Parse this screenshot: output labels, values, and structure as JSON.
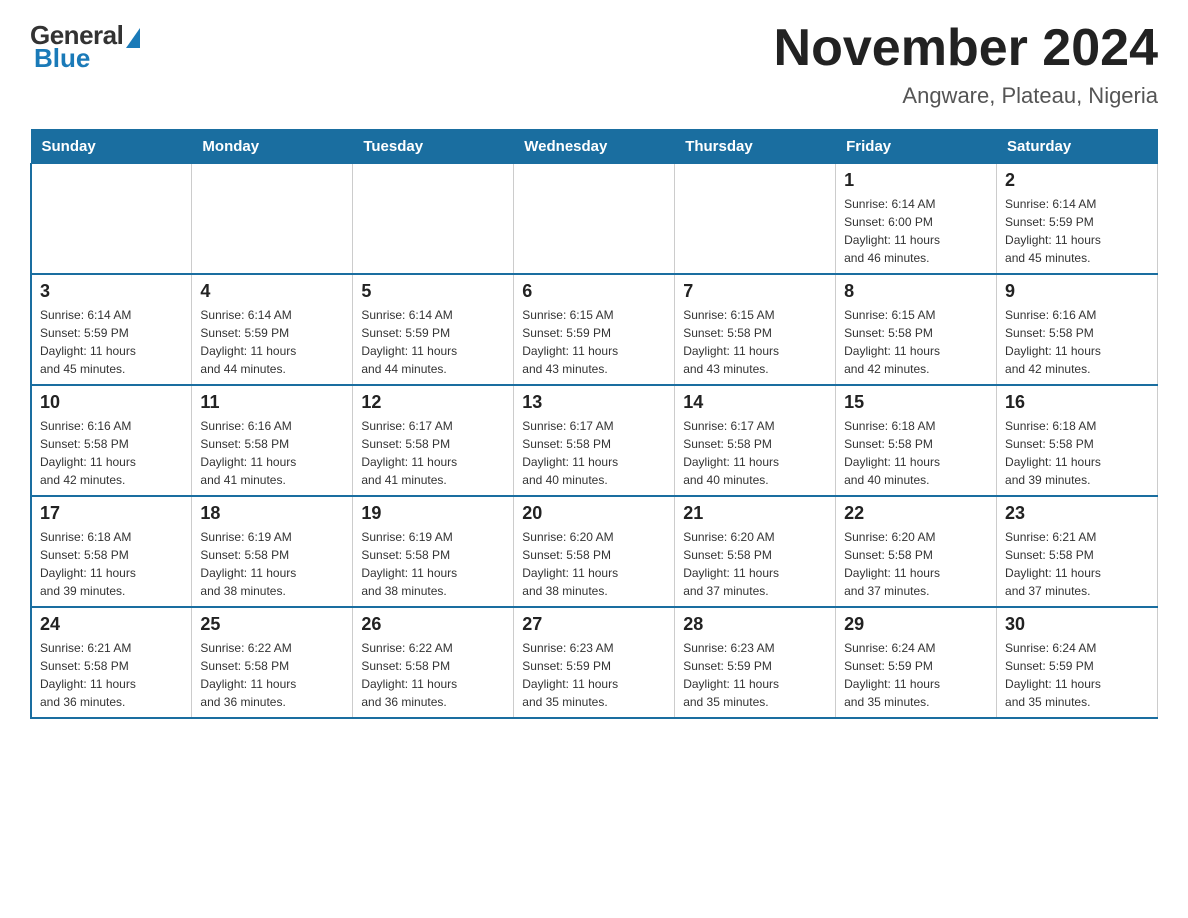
{
  "logo": {
    "general": "General",
    "blue": "Blue"
  },
  "title": "November 2024",
  "subtitle": "Angware, Plateau, Nigeria",
  "days_of_week": [
    "Sunday",
    "Monday",
    "Tuesday",
    "Wednesday",
    "Thursday",
    "Friday",
    "Saturday"
  ],
  "weeks": [
    [
      {
        "day": "",
        "info": ""
      },
      {
        "day": "",
        "info": ""
      },
      {
        "day": "",
        "info": ""
      },
      {
        "day": "",
        "info": ""
      },
      {
        "day": "",
        "info": ""
      },
      {
        "day": "1",
        "info": "Sunrise: 6:14 AM\nSunset: 6:00 PM\nDaylight: 11 hours\nand 46 minutes."
      },
      {
        "day": "2",
        "info": "Sunrise: 6:14 AM\nSunset: 5:59 PM\nDaylight: 11 hours\nand 45 minutes."
      }
    ],
    [
      {
        "day": "3",
        "info": "Sunrise: 6:14 AM\nSunset: 5:59 PM\nDaylight: 11 hours\nand 45 minutes."
      },
      {
        "day": "4",
        "info": "Sunrise: 6:14 AM\nSunset: 5:59 PM\nDaylight: 11 hours\nand 44 minutes."
      },
      {
        "day": "5",
        "info": "Sunrise: 6:14 AM\nSunset: 5:59 PM\nDaylight: 11 hours\nand 44 minutes."
      },
      {
        "day": "6",
        "info": "Sunrise: 6:15 AM\nSunset: 5:59 PM\nDaylight: 11 hours\nand 43 minutes."
      },
      {
        "day": "7",
        "info": "Sunrise: 6:15 AM\nSunset: 5:58 PM\nDaylight: 11 hours\nand 43 minutes."
      },
      {
        "day": "8",
        "info": "Sunrise: 6:15 AM\nSunset: 5:58 PM\nDaylight: 11 hours\nand 42 minutes."
      },
      {
        "day": "9",
        "info": "Sunrise: 6:16 AM\nSunset: 5:58 PM\nDaylight: 11 hours\nand 42 minutes."
      }
    ],
    [
      {
        "day": "10",
        "info": "Sunrise: 6:16 AM\nSunset: 5:58 PM\nDaylight: 11 hours\nand 42 minutes."
      },
      {
        "day": "11",
        "info": "Sunrise: 6:16 AM\nSunset: 5:58 PM\nDaylight: 11 hours\nand 41 minutes."
      },
      {
        "day": "12",
        "info": "Sunrise: 6:17 AM\nSunset: 5:58 PM\nDaylight: 11 hours\nand 41 minutes."
      },
      {
        "day": "13",
        "info": "Sunrise: 6:17 AM\nSunset: 5:58 PM\nDaylight: 11 hours\nand 40 minutes."
      },
      {
        "day": "14",
        "info": "Sunrise: 6:17 AM\nSunset: 5:58 PM\nDaylight: 11 hours\nand 40 minutes."
      },
      {
        "day": "15",
        "info": "Sunrise: 6:18 AM\nSunset: 5:58 PM\nDaylight: 11 hours\nand 40 minutes."
      },
      {
        "day": "16",
        "info": "Sunrise: 6:18 AM\nSunset: 5:58 PM\nDaylight: 11 hours\nand 39 minutes."
      }
    ],
    [
      {
        "day": "17",
        "info": "Sunrise: 6:18 AM\nSunset: 5:58 PM\nDaylight: 11 hours\nand 39 minutes."
      },
      {
        "day": "18",
        "info": "Sunrise: 6:19 AM\nSunset: 5:58 PM\nDaylight: 11 hours\nand 38 minutes."
      },
      {
        "day": "19",
        "info": "Sunrise: 6:19 AM\nSunset: 5:58 PM\nDaylight: 11 hours\nand 38 minutes."
      },
      {
        "day": "20",
        "info": "Sunrise: 6:20 AM\nSunset: 5:58 PM\nDaylight: 11 hours\nand 38 minutes."
      },
      {
        "day": "21",
        "info": "Sunrise: 6:20 AM\nSunset: 5:58 PM\nDaylight: 11 hours\nand 37 minutes."
      },
      {
        "day": "22",
        "info": "Sunrise: 6:20 AM\nSunset: 5:58 PM\nDaylight: 11 hours\nand 37 minutes."
      },
      {
        "day": "23",
        "info": "Sunrise: 6:21 AM\nSunset: 5:58 PM\nDaylight: 11 hours\nand 37 minutes."
      }
    ],
    [
      {
        "day": "24",
        "info": "Sunrise: 6:21 AM\nSunset: 5:58 PM\nDaylight: 11 hours\nand 36 minutes."
      },
      {
        "day": "25",
        "info": "Sunrise: 6:22 AM\nSunset: 5:58 PM\nDaylight: 11 hours\nand 36 minutes."
      },
      {
        "day": "26",
        "info": "Sunrise: 6:22 AM\nSunset: 5:58 PM\nDaylight: 11 hours\nand 36 minutes."
      },
      {
        "day": "27",
        "info": "Sunrise: 6:23 AM\nSunset: 5:59 PM\nDaylight: 11 hours\nand 35 minutes."
      },
      {
        "day": "28",
        "info": "Sunrise: 6:23 AM\nSunset: 5:59 PM\nDaylight: 11 hours\nand 35 minutes."
      },
      {
        "day": "29",
        "info": "Sunrise: 6:24 AM\nSunset: 5:59 PM\nDaylight: 11 hours\nand 35 minutes."
      },
      {
        "day": "30",
        "info": "Sunrise: 6:24 AM\nSunset: 5:59 PM\nDaylight: 11 hours\nand 35 minutes."
      }
    ]
  ]
}
